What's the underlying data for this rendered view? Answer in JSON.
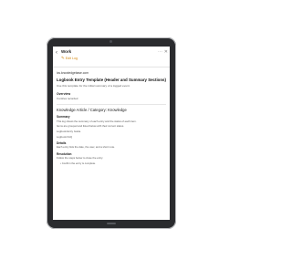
{
  "header": {
    "back_label": "Work",
    "edit_label": "Edit Log"
  },
  "article": {
    "url": "ics.knowledgebase.com",
    "title": "Logbook Entry Template (Header and Summary Sections)",
    "subtitle": "Use this template for the initial summary of a logged event.",
    "overview_heading": "Overview",
    "overview_text": "3 entries recorded",
    "knowledge_title": "Knowledge Article / Category: Knowledge",
    "summary_heading": "Summary",
    "summary_paragraphs": [
      "This log shows the summary of each entry and the status of each item.",
      "Items are grouped and listed below with their current status."
    ],
    "links": [
      "Logbook Entry Guide",
      "Logbook FAQ"
    ],
    "details_heading": "Details",
    "details_text": "Each entry lists the date, the user, and a short note.",
    "resolution_heading": "Resolution",
    "resolution_text": "Follow the steps below to close the entry.",
    "bullet": "Confirm the entry is complete."
  }
}
